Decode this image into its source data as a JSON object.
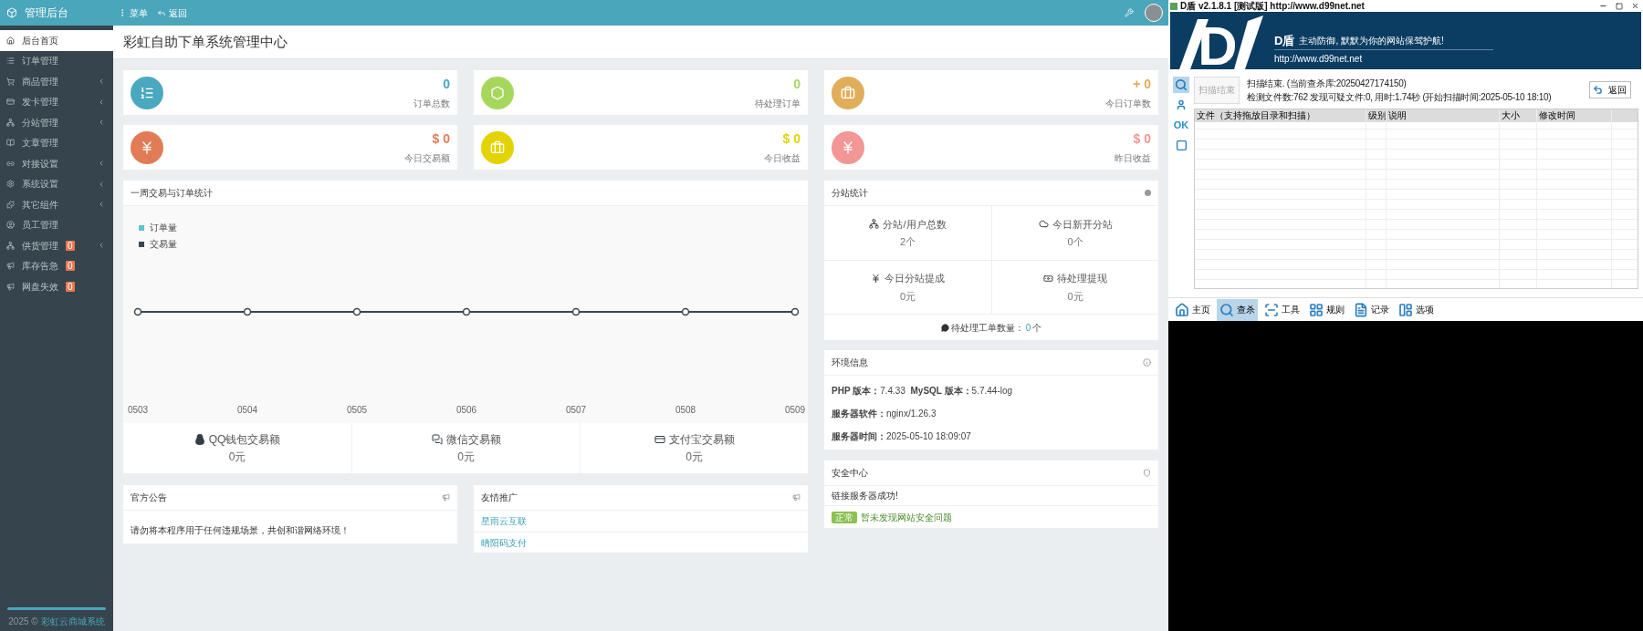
{
  "topbar": {
    "brand": "管理后台",
    "menu": "菜单",
    "back": "返回"
  },
  "sidebar": {
    "items": [
      {
        "label": "后台首页",
        "selected": true,
        "has_submenu": false
      },
      {
        "label": "订单管理",
        "selected": false,
        "has_submenu": false
      },
      {
        "label": "商品管理",
        "selected": false,
        "has_submenu": true
      },
      {
        "label": "发卡管理",
        "selected": false,
        "has_submenu": true
      },
      {
        "label": "分站管理",
        "selected": false,
        "has_submenu": true
      },
      {
        "label": "文章管理",
        "selected": false,
        "has_submenu": false
      },
      {
        "label": "对接设置",
        "selected": false,
        "has_submenu": true
      },
      {
        "label": "系统设置",
        "selected": false,
        "has_submenu": true
      },
      {
        "label": "其它组件",
        "selected": false,
        "has_submenu": true
      },
      {
        "label": "员工管理",
        "selected": false,
        "has_submenu": false
      },
      {
        "label": "供货管理",
        "selected": false,
        "has_submenu": true,
        "badge": "0"
      },
      {
        "label": "库存告急",
        "selected": false,
        "has_submenu": false,
        "badge": "0"
      },
      {
        "label": "网盘失效",
        "selected": false,
        "has_submenu": false,
        "badge": "0"
      }
    ],
    "footer": {
      "year": "2025 ©",
      "link": "彩虹云商城系统"
    }
  },
  "page_title": "彩虹自助下单系统管理中心",
  "stats": [
    {
      "value": "0",
      "label": "订单总数",
      "color": "#4aa8c0"
    },
    {
      "value": "0",
      "label": "待处理订单",
      "color": "#a6d75c"
    },
    {
      "value": "+ 0",
      "label": "今日订单数",
      "color": "#e0ae5a"
    },
    {
      "value": "$ 0",
      "label": "今日交易额",
      "color": "#e27c56"
    },
    {
      "value": "$ 0",
      "label": "今日收益",
      "color": "#e3d300"
    },
    {
      "value": "$ 0",
      "label": "昨日收益",
      "color": "#f29696"
    }
  ],
  "chart_panel": {
    "title": "一周交易与订单统计",
    "legend": [
      {
        "name": "订单量",
        "color": "#5cc4cc"
      },
      {
        "name": "交易量",
        "color": "#3a4650"
      }
    ],
    "x_labels": [
      "0503",
      "0504",
      "0505",
      "0506",
      "0507",
      "0508",
      "0509"
    ],
    "payments": [
      {
        "label": "QQ钱包交易额",
        "value": "0元"
      },
      {
        "label": "微信交易额",
        "value": "0元"
      },
      {
        "label": "支付宝交易额",
        "value": "0元"
      }
    ]
  },
  "notice": {
    "title": "官方公告",
    "text": "请勿将本程序用于任何违规场景，共创和谐网络环境！"
  },
  "links": {
    "title": "友情推广",
    "items": [
      "星雨云互联",
      "晴阳码支付"
    ]
  },
  "substation": {
    "title": "分站统计",
    "cells": [
      {
        "label": "分站/用户总数",
        "value": "2个"
      },
      {
        "label": "今日新开分站",
        "value": "0个"
      },
      {
        "label": "今日分站提成",
        "value": "0元"
      },
      {
        "label": "待处理提现",
        "value": "0元"
      }
    ],
    "footer": {
      "label": "待处理工单数量：",
      "count": "0",
      "unit": "个"
    }
  },
  "environment": {
    "title": "环境信息",
    "lines": [
      "**PHP 版本：**7.4.33  **MySQL 版本：**5.7.44-log",
      "**服务器软件：**nginx/1.26.3",
      "**服务器时间：**2025-05-10 18:09:07"
    ]
  },
  "security": {
    "title": "安全中心",
    "message": "链接服务器成功!",
    "badge": "正常",
    "status": "暂未发现网站安全问题"
  },
  "dshield": {
    "title": "D盾 v2.1.8.1 [测试版] http://www.d99net.net",
    "banner": {
      "logo_letter": "D",
      "brand": "D盾",
      "slogan": "主动防御, 默默为你的网站保驾护航!",
      "url": "http://www.d99net.net"
    },
    "side_tools": [
      {
        "kind": "search",
        "selected": true
      },
      {
        "kind": "person",
        "selected": false
      },
      {
        "kind": "text",
        "label": "OK",
        "selected": false
      },
      {
        "kind": "frame",
        "selected": false
      }
    ],
    "scan_button": {
      "label": "扫描结束",
      "disabled": true
    },
    "status_lines": [
      "扫描结束. (当前查杀库:20250427174150)",
      "检测文件数:762 发现可疑文件:0, 用时:1.74秒 (开始扫描时间:2025-05-10 18:10)"
    ],
    "back_button": "返回",
    "table": {
      "columns": [
        "文件（支持拖放目录和扫描）",
        "级别",
        "说明",
        "大小",
        "修改时间"
      ]
    },
    "tabs": [
      {
        "label": "主页",
        "selected": false
      },
      {
        "label": "查杀",
        "selected": true
      },
      {
        "label": "工具",
        "selected": false
      },
      {
        "label": "规则",
        "selected": false
      },
      {
        "label": "记录",
        "selected": false
      },
      {
        "label": "选项",
        "selected": false
      }
    ]
  }
}
